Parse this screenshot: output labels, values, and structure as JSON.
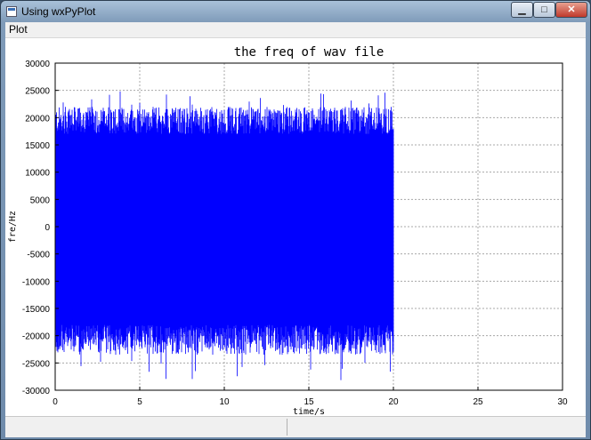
{
  "window": {
    "title": "Using wxPyPlot",
    "minimize_glyph": "▁",
    "maximize_glyph": "□",
    "close_glyph": "✕"
  },
  "menu": {
    "items": [
      "Plot"
    ]
  },
  "chart_data": {
    "type": "line",
    "title": "the freq of wav file",
    "xlabel": "time/s",
    "ylabel": "fre/Hz",
    "xlim": [
      0,
      30
    ],
    "ylim": [
      -30000,
      30000
    ],
    "xticks": [
      0,
      5,
      10,
      15,
      20,
      25,
      30
    ],
    "yticks": [
      30000,
      25000,
      20000,
      15000,
      10000,
      5000,
      0,
      -5000,
      -10000,
      -15000,
      -20000,
      -25000,
      -30000
    ],
    "grid": true,
    "series": [
      {
        "color": "#0000ff",
        "x_range": [
          0,
          20
        ],
        "approx_envelope": {
          "upper_typical": 20000,
          "upper_peak": 25000,
          "lower_typical": -20000,
          "lower_peak": -28500
        }
      }
    ]
  }
}
